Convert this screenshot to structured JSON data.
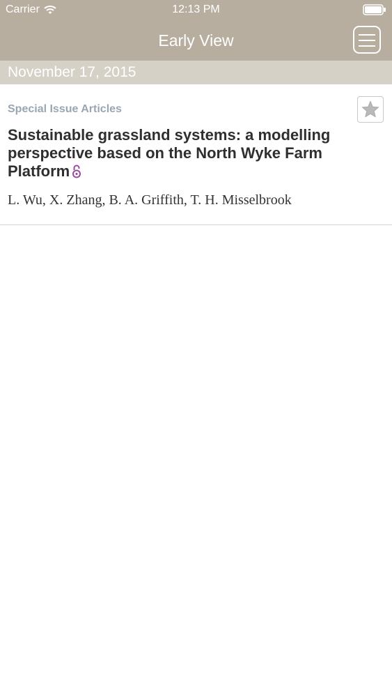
{
  "status_bar": {
    "carrier": "Carrier",
    "time": "12:13 PM",
    "wifi_icon": "wifi-icon",
    "battery_icon": "battery-icon"
  },
  "nav": {
    "title": "Early View",
    "menu_icon": "hamburger-menu-icon"
  },
  "section": {
    "date": "November 17, 2015"
  },
  "articles": [
    {
      "category": "Special Issue Articles",
      "title": "Sustainable grassland systems: a modelling perspective based on the North Wyke Farm Platform",
      "authors": "L. Wu, X. Zhang, B. A. Griffith, T. H. Misselbrook",
      "open_access_icon": "open-access-lock-icon",
      "favorite_icon": "star-icon"
    }
  ],
  "colors": {
    "nav_background": "#b7ae9f",
    "date_header_background": "#d6d1c6",
    "category_text": "#9aa6b4",
    "open_access": "#9b4b9e"
  }
}
